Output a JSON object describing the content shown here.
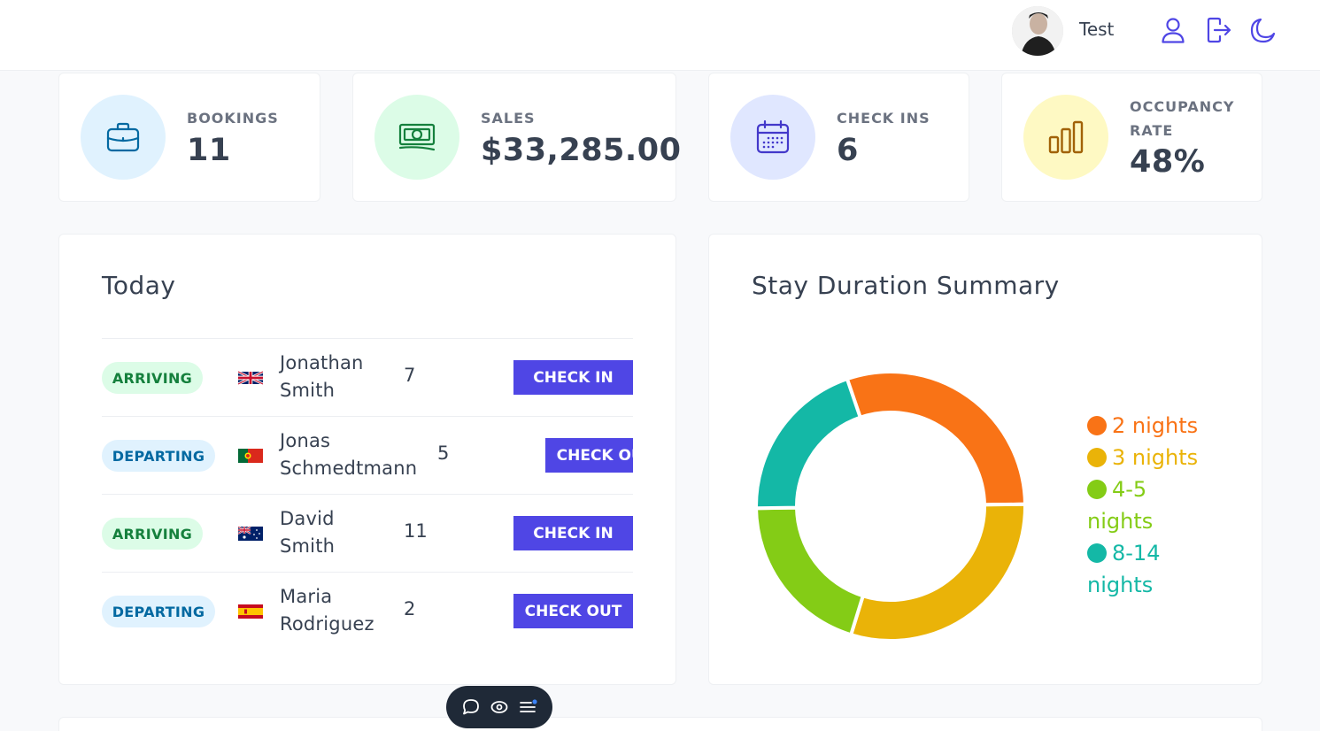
{
  "header": {
    "user_name": "Test",
    "icons": [
      "user-icon",
      "logout-icon",
      "moon-icon"
    ],
    "accent_color": "#4f46e5"
  },
  "stats": [
    {
      "label": "BOOKINGS",
      "value": "11",
      "icon": "briefcase-icon",
      "bg": "#e0f2fe",
      "color": "#0369a1"
    },
    {
      "label": "SALES",
      "value": "$33,285.00",
      "icon": "banknotes-icon",
      "bg": "#dcfce7",
      "color": "#15803d"
    },
    {
      "label": "CHECK INS",
      "value": "6",
      "icon": "calendar-icon",
      "bg": "#e0e7ff",
      "color": "#4338ca"
    },
    {
      "label_line1": "OCCUPANCY",
      "label_line2": "RATE",
      "value": "48%",
      "icon": "chart-bar-icon",
      "bg": "#fef9c3",
      "color": "#a16207"
    }
  ],
  "today": {
    "title": "Today",
    "rows": [
      {
        "status": "ARRIVING",
        "flag": "gb-flag-icon",
        "name_line1": "Jonathan",
        "name_line2": "Smith",
        "guests": "7",
        "action": "CHECK IN"
      },
      {
        "status": "DEPARTING",
        "flag": "pt-flag-icon",
        "name_line1": "Jonas",
        "name_line2": "Schmedtmann",
        "guests": "5",
        "action": "CHECK OUT"
      },
      {
        "status": "ARRIVING",
        "flag": "au-flag-icon",
        "name_line1": "David",
        "name_line2": "Smith",
        "guests": "11",
        "action": "CHECK IN"
      },
      {
        "status": "DEPARTING",
        "flag": "es-flag-icon",
        "name_line1": "Maria",
        "name_line2": "Rodriguez",
        "guests": "2",
        "action": "CHECK OUT"
      }
    ]
  },
  "stay_summary": {
    "title": "Stay Duration Summary"
  },
  "chart_data": {
    "type": "pie",
    "title": "Stay Duration Summary",
    "donut": true,
    "legend_position": "right",
    "categories": [
      "2 nights",
      "3 nights",
      "4-5 nights",
      "8-14 nights"
    ],
    "legend_labels": [
      {
        "line1": "2 nights",
        "line2": ""
      },
      {
        "line1": "3 nights",
        "line2": ""
      },
      {
        "line1": "4-5",
        "line2": "nights"
      },
      {
        "line1": "8-14",
        "line2": "nights"
      }
    ],
    "values": [
      3,
      3,
      2,
      2
    ],
    "colors": [
      "#f97316",
      "#eab308",
      "#84cc16",
      "#14b8a6"
    ]
  },
  "float_toolbar": {
    "icons": [
      "comment-icon",
      "eye-icon",
      "menu-icon"
    ]
  }
}
